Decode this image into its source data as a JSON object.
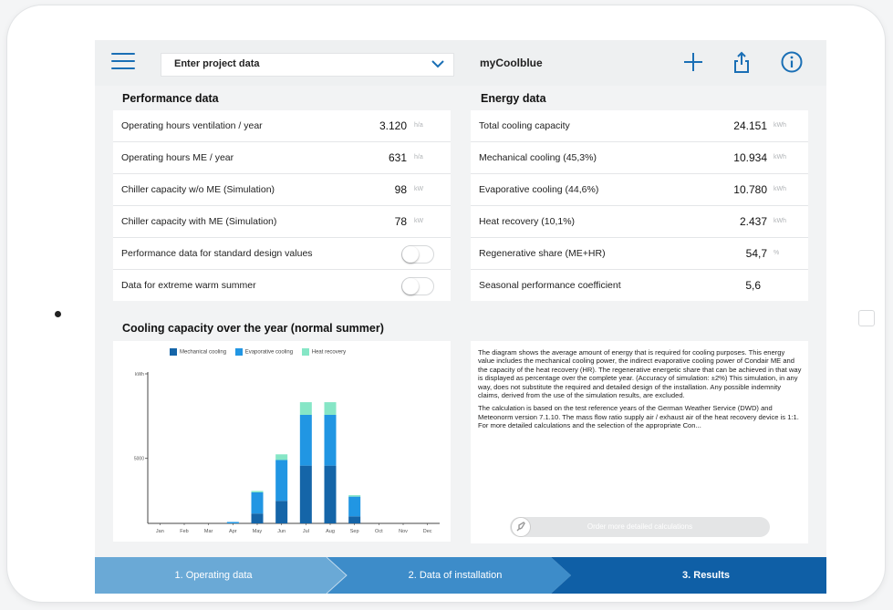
{
  "header": {
    "project_label": "Enter project data",
    "app_title": "myCoolblue"
  },
  "performance": {
    "title": "Performance data",
    "rows": [
      {
        "label": "Operating hours ventilation / year",
        "value": "3.120",
        "unit": "h/a"
      },
      {
        "label": "Operating hours ME / year",
        "value": "631",
        "unit": "h/a"
      },
      {
        "label": "Chiller capacity w/o ME (Simulation)",
        "value": "98",
        "unit": "kW"
      },
      {
        "label": "Chiller capacity with ME (Simulation)",
        "value": "78",
        "unit": "kW"
      }
    ],
    "toggles": [
      {
        "label": "Performance data for standard design values",
        "on": false
      },
      {
        "label": "Data for extreme warm summer",
        "on": false
      }
    ]
  },
  "energy": {
    "title": "Energy data",
    "rows": [
      {
        "label": "Total cooling capacity",
        "value": "24.151",
        "unit": "kWh"
      },
      {
        "label": "Mechanical cooling (45,3%)",
        "value": "10.934",
        "unit": "kWh"
      },
      {
        "label": "Evaporative cooling (44,6%)",
        "value": "10.780",
        "unit": "kWh"
      },
      {
        "label": "Heat recovery (10,1%)",
        "value": "2.437",
        "unit": "kWh"
      },
      {
        "label": "Regenerative share (ME+HR)",
        "value": "54,7",
        "unit": "%"
      },
      {
        "label": "Seasonal performance coefficient",
        "value": "5,6",
        "unit": ""
      }
    ]
  },
  "chart_title": "Cooling capacity over the year (normal summer)",
  "chart_data": {
    "type": "bar",
    "stacked": true,
    "categories": [
      "Jan",
      "Feb",
      "Mar",
      "Apr",
      "May",
      "Jun",
      "Jul",
      "Aug",
      "Sep",
      "Oct",
      "Nov",
      "Dec"
    ],
    "series": [
      {
        "name": "Mechanical cooling",
        "color": "#1565a8",
        "values": [
          0,
          0,
          0,
          0,
          700,
          1600,
          4100,
          4100,
          500,
          0,
          0,
          0
        ]
      },
      {
        "name": "Evaporative cooling",
        "color": "#2196e3",
        "values": [
          0,
          0,
          0,
          100,
          1500,
          2900,
          3600,
          3600,
          1400,
          0,
          0,
          0
        ]
      },
      {
        "name": "Heat recovery",
        "color": "#86e6c6",
        "values": [
          0,
          0,
          0,
          0,
          100,
          400,
          900,
          900,
          100,
          0,
          0,
          0
        ]
      }
    ],
    "yticks": [
      "kWh",
      "5000"
    ],
    "ylim": [
      0,
      11000
    ],
    "legend_position": "top"
  },
  "description": {
    "paragraphs": [
      "The diagram shows the average amount of energy that is required for cooling purposes. This energy value includes the mechanical cooling power, the indirect evaporative cooling power of Condair ME and the capacity of the heat recovery (HR). The regenerative energetic share that can be achieved in that way is displayed as percentage over the complete year. (Accuracy of simulation: ±2%) This simulation, in any way, does not substitute the required and detailed design of the installation. Any possible indemnity claims, derived from the use of the simulation results, are excluded.",
      "The calculation is based on the test reference years of the German Weather Service (DWD) and Meteonorm version 7.1.10. The mass flow ratio supply air / exhaust air of the heat recovery device is 1:1. For more detailed calculations and the selection of the appropriate Con..."
    ],
    "button_label": "Order more detailed calculations"
  },
  "steps": [
    {
      "label": "1. Operating data",
      "color": "#6aa9d6"
    },
    {
      "label": "2. Data of installation",
      "color": "#3d8cc9"
    },
    {
      "label": "3. Results",
      "color": "#0f5fa6"
    }
  ]
}
